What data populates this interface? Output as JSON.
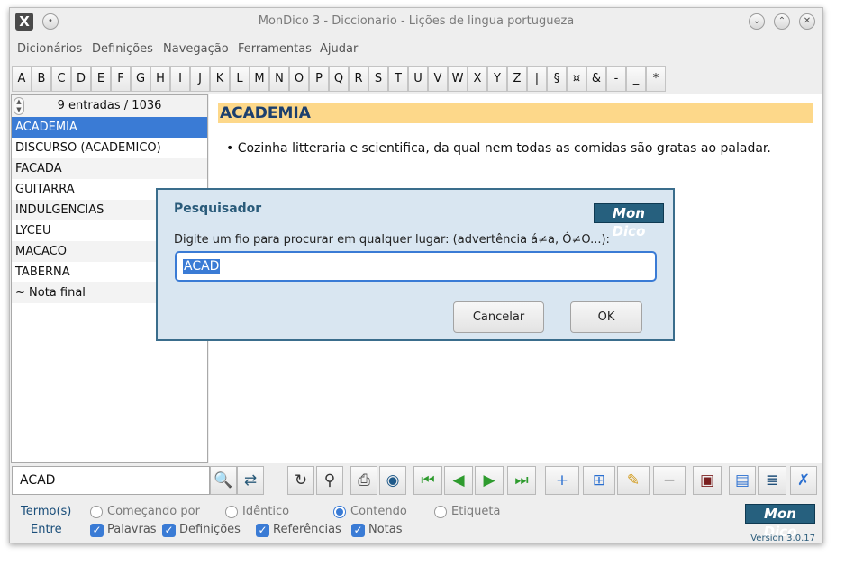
{
  "window": {
    "title": "MonDico 3 - Diccionario - Lições de lingua portugueza",
    "app_icon_glyph": "X"
  },
  "menu": [
    "Dicionários",
    "Definições",
    "Navegação",
    "Ferramentas",
    "Ajudar"
  ],
  "alphabet": [
    "A",
    "B",
    "C",
    "D",
    "E",
    "F",
    "G",
    "H",
    "I",
    "J",
    "K",
    "L",
    "M",
    "N",
    "O",
    "P",
    "Q",
    "R",
    "S",
    "T",
    "U",
    "V",
    "W",
    "X",
    "Y",
    "Z",
    "|",
    "§",
    "¤",
    "&",
    "-",
    "_",
    "*"
  ],
  "list": {
    "count": "9 entradas / 1036",
    "items": [
      "ACADEMIA",
      "DISCURSO (ACADEMICO)",
      "FACADA",
      "GUITARRA",
      "INDULGENCIAS",
      "LYCEU",
      "MACACO",
      "TABERNA",
      "~ Nota final"
    ],
    "selected_index": 0
  },
  "entry": {
    "title": "ACADEMIA",
    "definition": "• Cozinha litteraria e scientifica, da qual nem todas as comidas são gratas ao paladar."
  },
  "dialog": {
    "title": "Pesquisador",
    "logo": "Mon Dico",
    "label": "Digite um fio para procurar em qualquer lugar: (advertência á≠a, Ó≠O...):",
    "value": "ACAD",
    "cancel": "Cancelar",
    "ok": "OK"
  },
  "search": {
    "value": "ACAD"
  },
  "toolbar_icons": [
    "search-text-icon",
    "refresh-icon",
    "reload-icon",
    "magnifier-icon",
    "printer-icon",
    "globe-icon",
    "first-icon",
    "previous-icon",
    "next-icon",
    "last-icon",
    "add-icon",
    "edit-entry-icon",
    "pencil-icon",
    "remove-icon",
    "save-icon",
    "dictionary-icon",
    "books-icon",
    "tools-icon"
  ],
  "options": {
    "termos_label": "Termo(s)",
    "entre_label": "Entre",
    "radios": [
      {
        "label": "Começando por",
        "checked": false
      },
      {
        "label": "Idêntico",
        "checked": false
      },
      {
        "label": "Contendo",
        "checked": true
      },
      {
        "label": "Etiqueta",
        "checked": false
      }
    ],
    "checks": [
      {
        "label": "Palavras",
        "checked": true
      },
      {
        "label": "Definições",
        "checked": true
      },
      {
        "label": "Referências",
        "checked": true
      },
      {
        "label": "Notas",
        "checked": true
      }
    ],
    "logo": "Mon Dico",
    "version": "Version 3.0.17"
  },
  "colors": {
    "accent": "#3a7bd5",
    "title_band": "#fdd88a",
    "title_text": "#1c3f6e",
    "dialog_bg": "#d9e6f1",
    "logo_bg": "#26607e"
  }
}
